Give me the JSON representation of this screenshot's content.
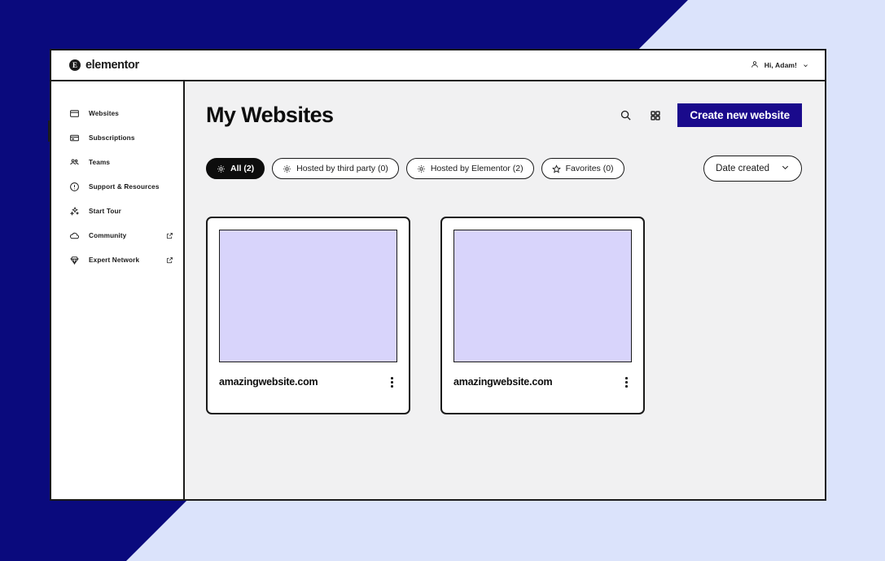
{
  "window": {
    "brand_name": "elementor",
    "brand_mark_letter": "E",
    "user_greeting": "Hi, Adam!"
  },
  "sidebar": {
    "items": [
      {
        "label": "Websites",
        "icon": "browser-window-icon",
        "external": false,
        "active": true
      },
      {
        "label": "Subscriptions",
        "icon": "card-icon",
        "external": false,
        "active": false
      },
      {
        "label": "Teams",
        "icon": "people-icon",
        "external": false,
        "active": false
      },
      {
        "label": "Support & Resources",
        "icon": "info-circle-icon",
        "external": false,
        "active": false
      },
      {
        "label": "Start Tour",
        "icon": "sparkles-icon",
        "external": false,
        "active": false
      },
      {
        "label": "Community",
        "icon": "cloud-icon",
        "external": true,
        "active": false
      },
      {
        "label": "Expert Network",
        "icon": "diamond-icon",
        "external": true,
        "active": false
      }
    ]
  },
  "main": {
    "page_title": "My Websites",
    "search_icon": "search-icon",
    "grid_view_icon": "grid-view-icon",
    "create_button_label": "Create new website",
    "sort": {
      "selected": "Date created",
      "chevron_icon": "chevron-down-icon"
    },
    "filters": [
      {
        "label": "All (2)",
        "icon": "sun-icon",
        "active": true
      },
      {
        "label": "Hosted by third party (0)",
        "icon": "sun-icon",
        "active": false
      },
      {
        "label": "Hosted by Elementor (2)",
        "icon": "sun-icon",
        "active": false
      },
      {
        "label": "Favorites (0)",
        "icon": "star-icon",
        "active": false
      }
    ],
    "cards": [
      {
        "title": "amazingwebsite.com",
        "menu_icon": "kebab-menu-icon"
      },
      {
        "title": "amazingwebsite.com",
        "menu_icon": "kebab-menu-icon"
      }
    ]
  },
  "theme": {
    "brand_navy": "#1A0A8C",
    "backdrop_light": "#DBE3FB",
    "backdrop_navy": "#0A0A7D",
    "thumb_lavender": "#D8D4FB",
    "content_bg": "#F1F1F2",
    "ink": "#1A1A1A"
  }
}
